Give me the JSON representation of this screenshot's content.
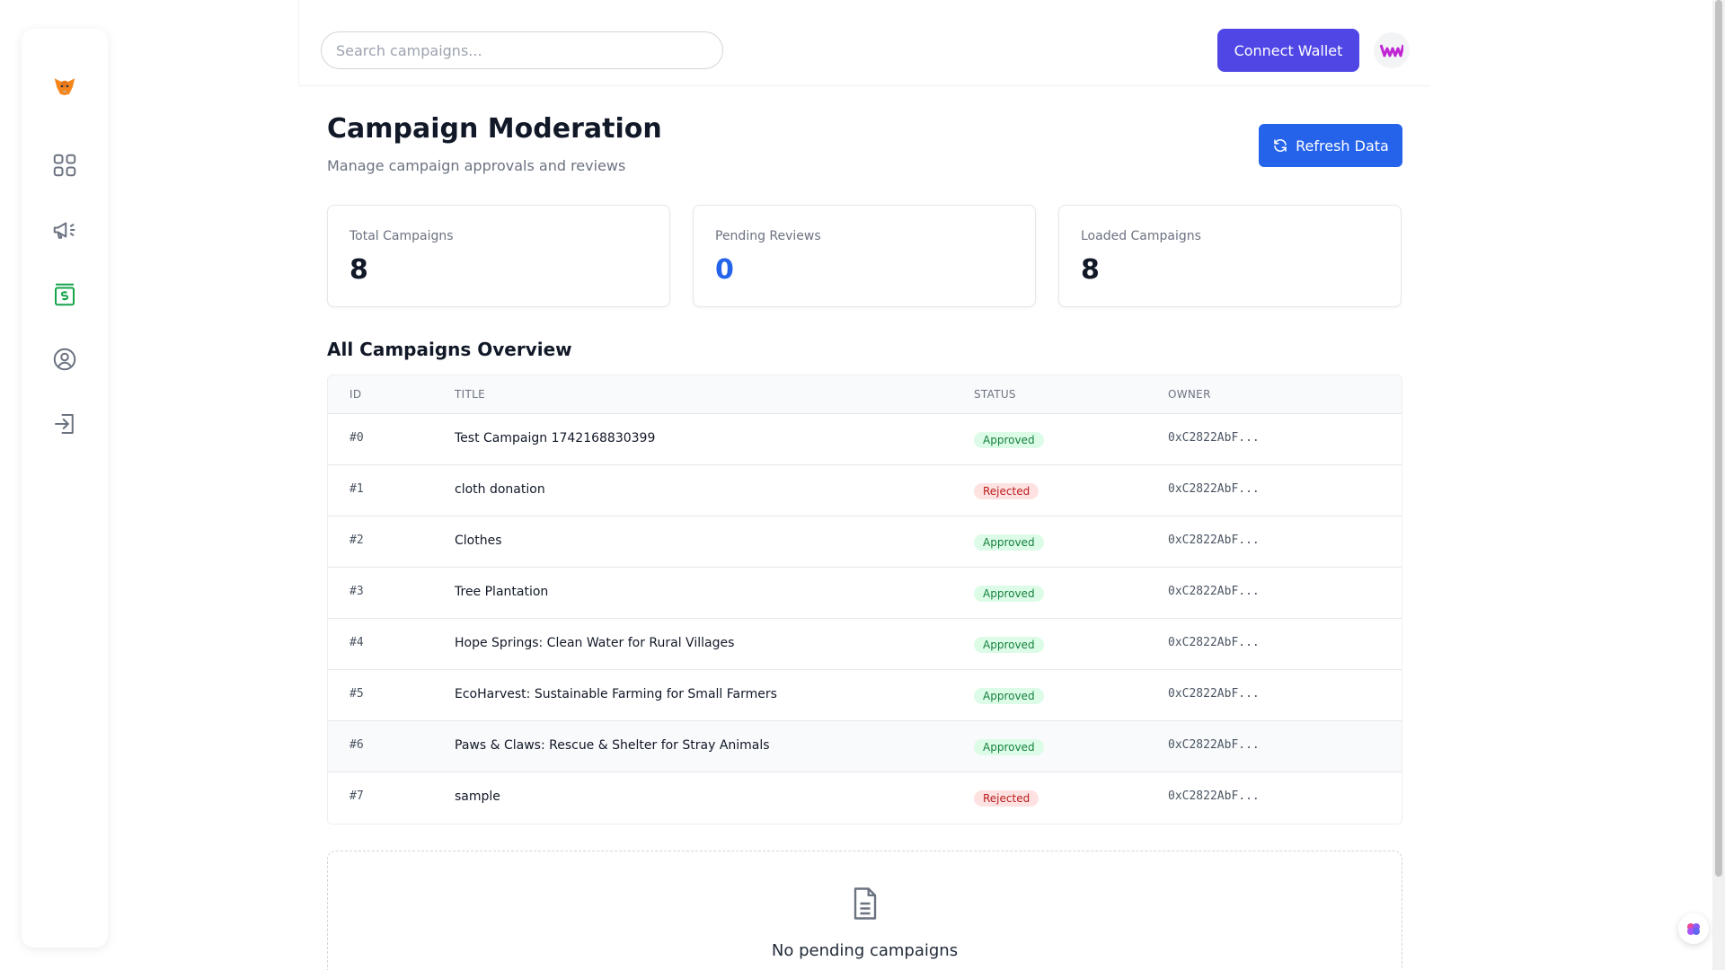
{
  "header": {
    "search_placeholder": "Search campaigns...",
    "connect_label": "Connect Wallet"
  },
  "page": {
    "title": "Campaign Moderation",
    "subtitle": "Manage campaign approvals and reviews",
    "refresh_label": "Refresh Data"
  },
  "stats": [
    {
      "label": "Total Campaigns",
      "value": "8"
    },
    {
      "label": "Pending Reviews",
      "value": "0"
    },
    {
      "label": "Loaded Campaigns",
      "value": "8"
    }
  ],
  "overview": {
    "title": "All Campaigns Overview",
    "columns": [
      "ID",
      "TITLE",
      "STATUS",
      "OWNER"
    ],
    "rows": [
      {
        "id": "#0",
        "title": "Test Campaign 1742168830399",
        "status": "Approved",
        "owner": "0xC2822AbF..."
      },
      {
        "id": "#1",
        "title": "cloth donation",
        "status": "Rejected",
        "owner": "0xC2822AbF..."
      },
      {
        "id": "#2",
        "title": "Clothes",
        "status": "Approved",
        "owner": "0xC2822AbF..."
      },
      {
        "id": "#3",
        "title": "Tree Plantation",
        "status": "Approved",
        "owner": "0xC2822AbF..."
      },
      {
        "id": "#4",
        "title": "Hope Springs: Clean Water for Rural Villages",
        "status": "Approved",
        "owner": "0xC2822AbF..."
      },
      {
        "id": "#5",
        "title": "EcoHarvest: Sustainable Farming for Small Farmers",
        "status": "Approved",
        "owner": "0xC2822AbF..."
      },
      {
        "id": "#6",
        "title": "Paws & Claws: Rescue & Shelter for Stray Animals",
        "status": "Approved",
        "owner": "0xC2822AbF..."
      },
      {
        "id": "#7",
        "title": "sample",
        "status": "Rejected",
        "owner": "0xC2822AbF..."
      }
    ]
  },
  "pending": {
    "empty_text": "No pending campaigns"
  },
  "sidebar": {
    "items": [
      "metamask-fox-icon",
      "dashboard-grid-icon",
      "megaphone-icon",
      "payment-icon",
      "profile-icon",
      "logout-icon"
    ],
    "active_color": "#16a34a"
  },
  "colors": {
    "primary": "#2563eb",
    "connect": "#4f46e5",
    "approved_bg": "#dcfce7",
    "approved_text": "#15803d",
    "rejected_bg": "#fee2e2",
    "rejected_text": "#b91c1c"
  }
}
